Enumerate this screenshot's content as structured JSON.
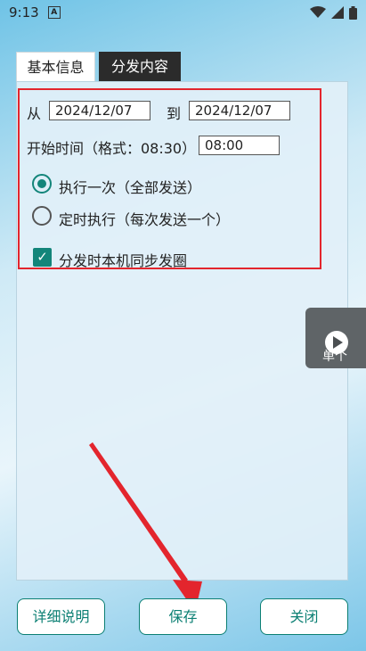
{
  "status_bar": {
    "time": "9:13",
    "notif_icon_glyph": "A",
    "icons": [
      "wifi-icon",
      "signal-icon",
      "battery-icon"
    ]
  },
  "tabs": [
    {
      "label": "基本信息"
    },
    {
      "label": "分发内容"
    }
  ],
  "date_range": {
    "from_label": "从",
    "from_value": "2024/12/07",
    "to_label": "到",
    "to_value": "2024/12/07"
  },
  "start_time": {
    "label": "开始时间（格式：08:30）",
    "value": "08:00"
  },
  "radios": [
    {
      "label": "执行一次（全部发送）",
      "checked": true
    },
    {
      "label": "定时执行（每次发送一个）",
      "checked": false
    }
  ],
  "sync_checkbox": {
    "label": "分发时本机同步发圈",
    "checked": true
  },
  "floating_button": {
    "label": "单个"
  },
  "buttons": {
    "detail": "详细说明",
    "save": "保存",
    "close": "关闭"
  },
  "colors": {
    "accent": "#13857a",
    "highlight": "#e3252d",
    "tab_active": "#2b2b2b"
  }
}
